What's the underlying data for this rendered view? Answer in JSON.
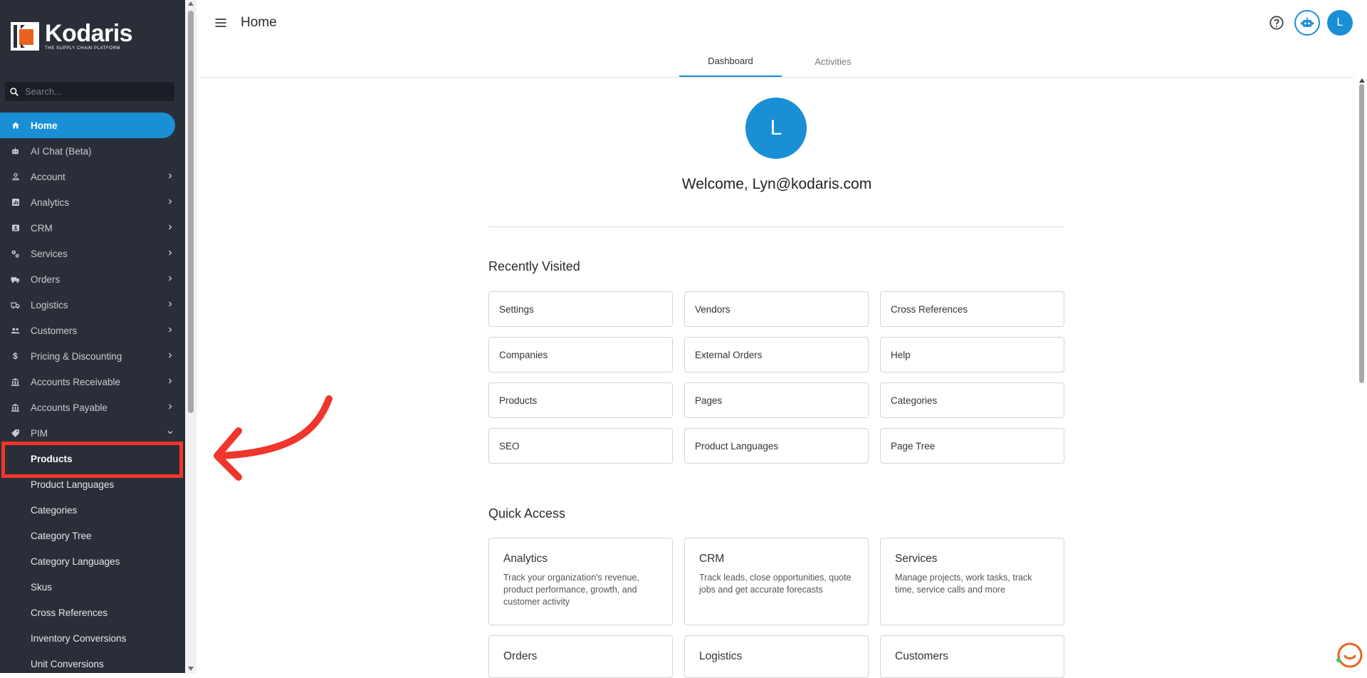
{
  "brand": {
    "name": "Kodaris",
    "tagline": "THE SUPPLY CHAIN PLATFORM",
    "accent": "#1a8fd6",
    "logo_orange": "#e8641e"
  },
  "sidebar": {
    "search_placeholder": "Search...",
    "items": [
      {
        "label": "Home",
        "icon": "home-icon",
        "active": true
      },
      {
        "label": "AI Chat (Beta)",
        "icon": "robot-icon"
      },
      {
        "label": "Account",
        "icon": "person-icon",
        "expandable": true
      },
      {
        "label": "Analytics",
        "icon": "chart-icon",
        "expandable": true
      },
      {
        "label": "CRM",
        "icon": "contact-card-icon",
        "expandable": true
      },
      {
        "label": "Services",
        "icon": "gears-icon",
        "expandable": true
      },
      {
        "label": "Orders",
        "icon": "truck-icon",
        "expandable": true
      },
      {
        "label": "Logistics",
        "icon": "delivery-icon",
        "expandable": true
      },
      {
        "label": "Customers",
        "icon": "people-icon",
        "expandable": true
      },
      {
        "label": "Pricing & Discounting",
        "icon": "dollar-icon",
        "expandable": true
      },
      {
        "label": "Accounts Receivable",
        "icon": "bank-icon",
        "expandable": true
      },
      {
        "label": "Accounts Payable",
        "icon": "bank-icon",
        "expandable": true
      },
      {
        "label": "PIM",
        "icon": "tag-icon",
        "expanded": true
      }
    ],
    "pim_children": [
      "Products",
      "Product Languages",
      "Categories",
      "Category Tree",
      "Category Languages",
      "Skus",
      "Cross References",
      "Inventory Conversions",
      "Unit Conversions"
    ]
  },
  "header": {
    "title": "Home",
    "user_initial": "L"
  },
  "tabs": [
    "Dashboard",
    "Activities"
  ],
  "welcome": {
    "initial": "L",
    "text": "Welcome, Lyn@kodaris.com"
  },
  "recently_visited": {
    "title": "Recently Visited",
    "items": [
      "Settings",
      "Vendors",
      "Cross References",
      "Companies",
      "External Orders",
      "Help",
      "Products",
      "Pages",
      "Categories",
      "SEO",
      "Product Languages",
      "Page Tree"
    ]
  },
  "quick_access": {
    "title": "Quick Access",
    "items": [
      {
        "title": "Analytics",
        "desc": "Track your organization's revenue, product performance, growth, and customer activity"
      },
      {
        "title": "CRM",
        "desc": "Track leads, close opportunities, quote jobs and get accurate forecasts"
      },
      {
        "title": "Services",
        "desc": "Manage projects, work tasks, track time, service calls and more"
      },
      {
        "title": "Orders",
        "desc": ""
      },
      {
        "title": "Logistics",
        "desc": ""
      },
      {
        "title": "Customers",
        "desc": ""
      }
    ]
  }
}
